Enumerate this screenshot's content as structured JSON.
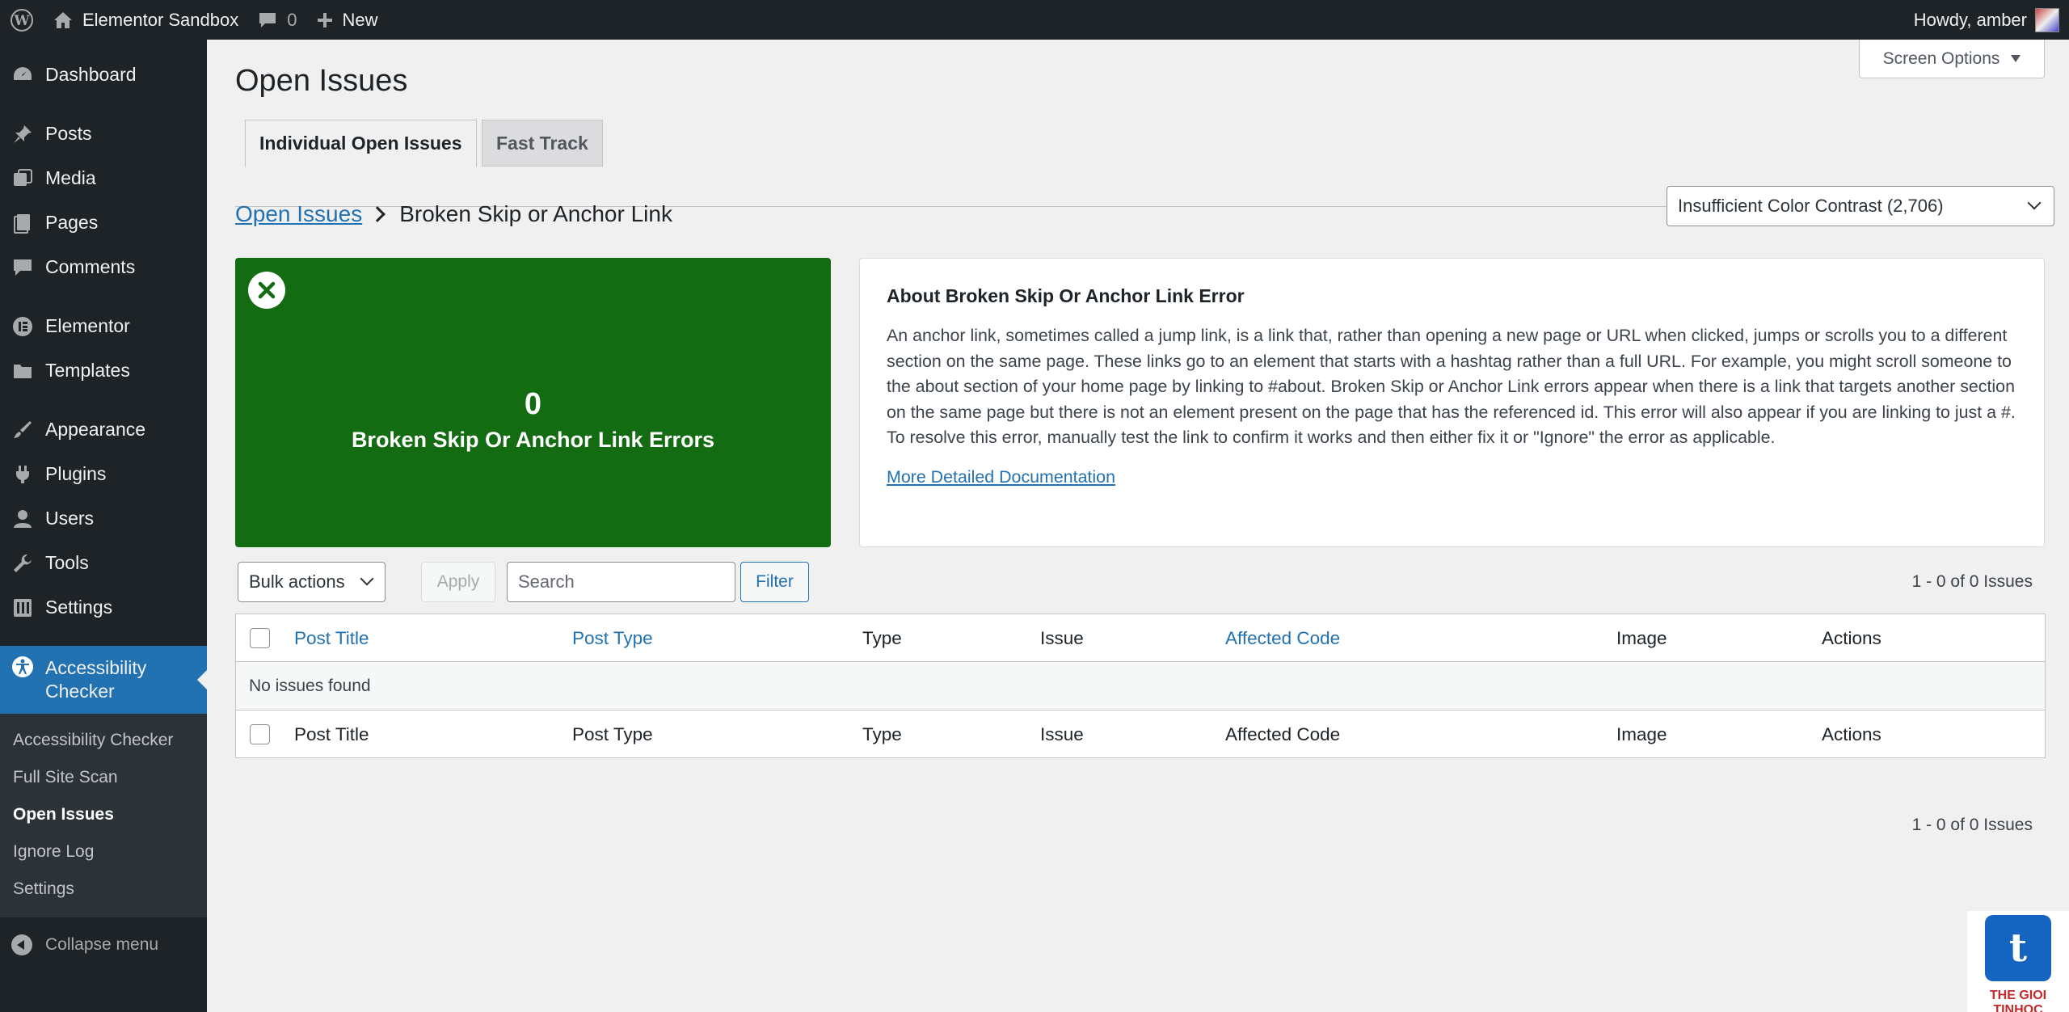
{
  "adminbar": {
    "site_name": "Elementor Sandbox",
    "comments_count": "0",
    "new_label": "New",
    "howdy": "Howdy, amber"
  },
  "sidebar": {
    "items": [
      {
        "label": "Dashboard",
        "icon": "dashboard-icon"
      },
      {
        "label": "Posts",
        "icon": "pin-icon"
      },
      {
        "label": "Media",
        "icon": "media-icon"
      },
      {
        "label": "Pages",
        "icon": "pages-icon"
      },
      {
        "label": "Comments",
        "icon": "comment-icon"
      },
      {
        "label": "Elementor",
        "icon": "elementor-icon"
      },
      {
        "label": "Templates",
        "icon": "folder-icon"
      },
      {
        "label": "Appearance",
        "icon": "brush-icon"
      },
      {
        "label": "Plugins",
        "icon": "plug-icon"
      },
      {
        "label": "Users",
        "icon": "user-icon"
      },
      {
        "label": "Tools",
        "icon": "wrench-icon"
      },
      {
        "label": "Settings",
        "icon": "settings-icon"
      }
    ],
    "active": {
      "label": "Accessibility Checker",
      "icon": "accessibility-icon"
    },
    "submenu": [
      "Accessibility Checker",
      "Full Site Scan",
      "Open Issues",
      "Ignore Log",
      "Settings"
    ],
    "collapse": "Collapse menu"
  },
  "screen_options": "Screen Options",
  "page_title": "Open Issues",
  "tabs": [
    "Individual Open Issues",
    "Fast Track"
  ],
  "breadcrumb": {
    "link": "Open Issues",
    "current": "Broken Skip or Anchor Link"
  },
  "issue_select": "Insufficient Color Contrast (2,706)",
  "summary": {
    "count": "0",
    "label": "Broken Skip Or Anchor Link Errors"
  },
  "about": {
    "title": "About Broken Skip Or Anchor Link Error",
    "body": "An anchor link, sometimes called a jump link, is a link that, rather than opening a new page or URL when clicked, jumps or scrolls you to a different section on the same page. These links go to an element that starts with a hashtag rather than a full URL. For example, you might scroll someone to the about section of your home page by linking to #about. Broken Skip or Anchor Link errors appear when there is a link that targets another section on the same page but there is not an element present on the page that has the referenced id. This error will also appear if you are linking to just a #. To resolve this error, manually test the link to confirm it works and then either fix it or \"Ignore\" the error as applicable.",
    "link": "More Detailed Documentation"
  },
  "tablenav": {
    "bulk_actions": "Bulk actions",
    "apply": "Apply",
    "search_placeholder": "Search",
    "filter": "Filter",
    "count": "1 - 0 of 0 Issues"
  },
  "table": {
    "columns": [
      "Post Title",
      "Post Type",
      "Type",
      "Issue",
      "Affected Code",
      "Image",
      "Actions"
    ],
    "empty": "No issues found"
  },
  "watermark": "THE GIOI TINHOC"
}
